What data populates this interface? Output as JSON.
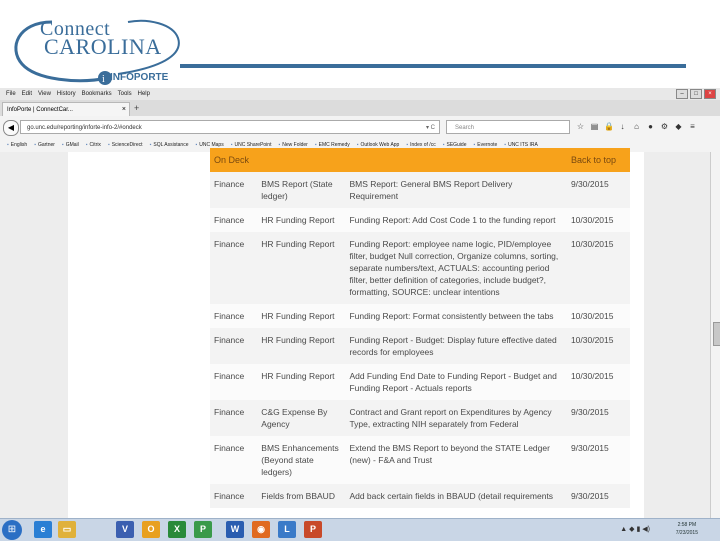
{
  "slide": {
    "logo_connect": "Connect",
    "logo_carolina": "Carolina",
    "logo_info": "INFOPORTE"
  },
  "browser": {
    "menu": [
      "File",
      "Edit",
      "View",
      "History",
      "Bookmarks",
      "Tools",
      "Help"
    ],
    "tab_title": "InfoPorte | ConnectCar...",
    "url": "go.unc.edu/reporting/inforte-info-2/#ondeck",
    "search_placeholder": "Search",
    "bookmarks": [
      "English",
      "Gartner",
      "GMail",
      "Citrix",
      "ScienceDirect",
      "SQL Assistance",
      "UNC Maps",
      "UNC SharePoint",
      "New Folder",
      "EMC Remedy",
      "Outlook Web App",
      "Index of /cc",
      "SEGuide",
      "Evernote",
      "UNC ITS IRA"
    ]
  },
  "table": {
    "header": {
      "col1": "On Deck",
      "col4": "Back to top"
    },
    "rows": [
      {
        "area": "Finance",
        "report": "BMS Report (State ledger)",
        "desc": "BMS Report: General BMS Report Delivery Requirement",
        "date": "9/30/2015"
      },
      {
        "area": "Finance",
        "report": "HR Funding Report",
        "desc": "Funding Report: Add Cost Code 1 to the funding report",
        "date": "10/30/2015"
      },
      {
        "area": "Finance",
        "report": "HR Funding Report",
        "desc": "Funding Report: employee name logic, PID/employee filter, budget Null correction, Organize columns, sorting, separate numbers/text, ACTUALS: accounting period filter, better definition of categories, include budget?, formatting, SOURCE: unclear intentions",
        "date": "10/30/2015"
      },
      {
        "area": "Finance",
        "report": "HR Funding Report",
        "desc": "Funding Report: Format consistently between the tabs",
        "date": "10/30/2015"
      },
      {
        "area": "Finance",
        "report": "HR Funding Report",
        "desc": "Funding Report - Budget: Display future effective dated records for employees",
        "date": "10/30/2015"
      },
      {
        "area": "Finance",
        "report": "HR Funding Report",
        "desc": "Add Funding End Date to Funding Report - Budget and Funding Report - Actuals reports",
        "date": "10/30/2015"
      },
      {
        "area": "Finance",
        "report": "C&G Expense By Agency",
        "desc": "Contract and Grant report on Expenditures by Agency Type, extracting NIH separately from Federal",
        "date": "9/30/2015"
      },
      {
        "area": "Finance",
        "report": "BMS Enhancements (Beyond state ledgers)",
        "desc": "Extend the BMS Report to beyond the STATE Ledger (new) - F&A and Trust",
        "date": "9/30/2015"
      },
      {
        "area": "Finance",
        "report": "Fields from BBAUD",
        "desc": "Add back certain fields in BBAUD (detail requirements",
        "date": "9/30/2015"
      }
    ]
  },
  "taskbar": {
    "time": "2:58 PM",
    "date": "7/23/2015"
  }
}
